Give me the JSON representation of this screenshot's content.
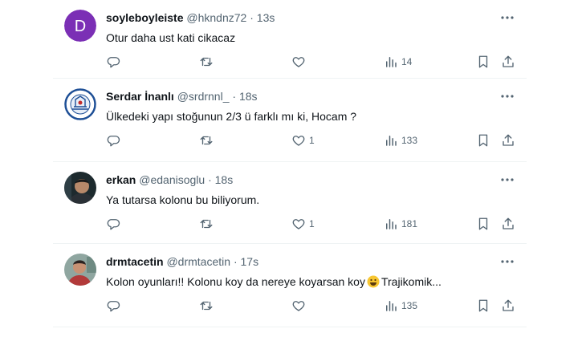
{
  "tweets": [
    {
      "name": "soyleboyleiste",
      "handle": "@hkndnz72",
      "dot": "·",
      "time": "13s",
      "avatar_letter": "D",
      "text": "Otur daha ust kati cikacaz",
      "text_after": "",
      "reply_count": "",
      "retweet_count": "",
      "like_count": "",
      "views": "14"
    },
    {
      "name": "Serdar İnanlı",
      "handle": "@srdrnnl_",
      "dot": "·",
      "time": "18s",
      "avatar_letter": "",
      "text": "Ülkedeki yapı stoğunun 2/3 ü farklı mı ki, Hocam ?",
      "text_after": "",
      "reply_count": "",
      "retweet_count": "",
      "like_count": "1",
      "views": "133"
    },
    {
      "name": "erkan",
      "handle": "@edanisoglu",
      "dot": "·",
      "time": "18s",
      "avatar_letter": "",
      "text": "Ya tutarsa kolonu bu biliyorum.",
      "text_after": "",
      "reply_count": "",
      "retweet_count": "",
      "like_count": "1",
      "views": "181"
    },
    {
      "name": "drmtacetin",
      "handle": "@drmtacetin",
      "dot": "·",
      "time": "17s",
      "avatar_letter": "",
      "text": "Kolon oyunları!! Kolonu koy da nereye koyarsan koy",
      "text_after": "Trajikomik...",
      "reply_count": "",
      "retweet_count": "",
      "like_count": "",
      "views": "135"
    }
  ],
  "colors": {
    "text": "#0f1419",
    "secondary": "#536471",
    "divider": "#eff3f4",
    "avatar_purple": "#7b2fb5"
  },
  "icons": [
    "reply-icon",
    "retweet-icon",
    "like-icon",
    "views-icon",
    "bookmark-icon",
    "share-icon",
    "more-icon",
    "smiley-emoji"
  ]
}
